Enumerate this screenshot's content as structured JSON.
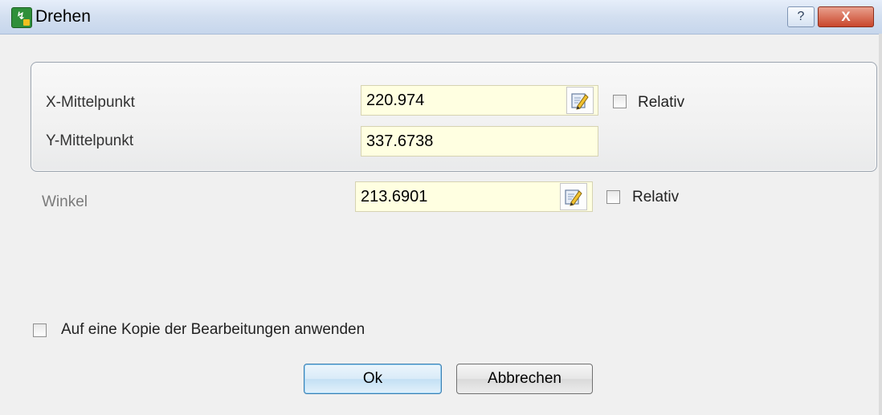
{
  "window": {
    "title": "Drehen",
    "help_label": "?",
    "close_label": "X"
  },
  "center_group": {
    "x_label": "X-Mittelpunkt",
    "x_value": "220.974",
    "x_relative_label": "Relativ",
    "x_relative_checked": false,
    "y_label": "Y-Mittelpunkt",
    "y_value": "337.6738"
  },
  "angle": {
    "label": "Winkel",
    "value": "213.6901",
    "relative_label": "Relativ",
    "relative_checked": false
  },
  "copy_option": {
    "label": "Auf eine Kopie der Bearbeitungen anwenden",
    "checked": false
  },
  "buttons": {
    "ok_label": "Ok",
    "cancel_label": "Abbrechen"
  },
  "icons": {
    "app": "app-icon",
    "edit": "edit-pencil-icon"
  },
  "colors": {
    "field_background": "#ffffe1",
    "title_bar": "#d3dff0",
    "close_button": "#c9462c"
  }
}
